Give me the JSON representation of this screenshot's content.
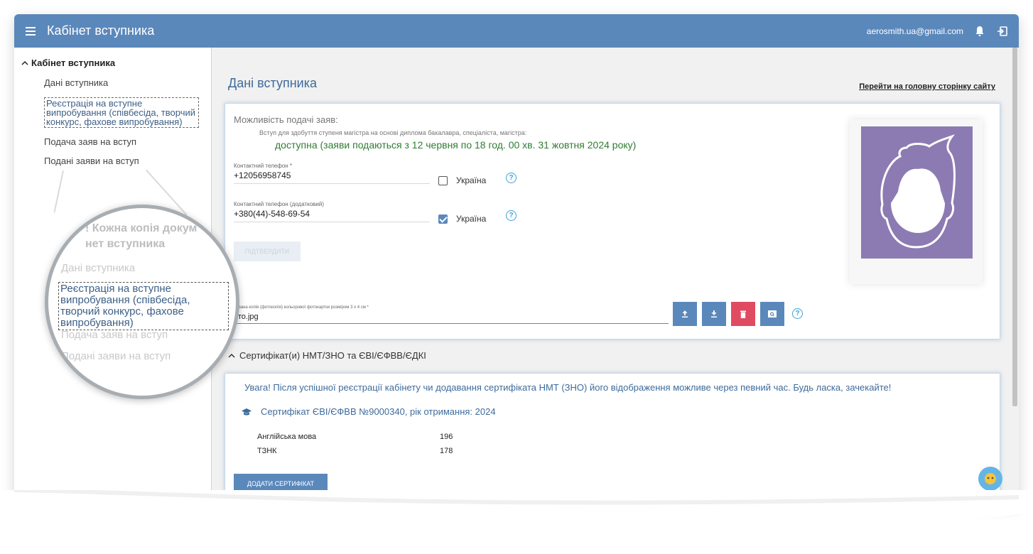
{
  "header": {
    "title": "Кабінет вступника",
    "user_email": "aerosmith.ua@gmail.com"
  },
  "sidebar": {
    "section_title": "Кабінет вступника",
    "items": [
      {
        "label": "Дані вступника"
      },
      {
        "label": "Реєстрація на вступне випробування (співбесіда, творчий конкурс, фахове випробування)"
      },
      {
        "label": "Подача заяв на вступ"
      },
      {
        "label": "Подані заяви на вступ"
      }
    ]
  },
  "main": {
    "page_title": "Дані вступника",
    "home_link": "Перейти на головну сторінку сайту",
    "applications": {
      "heading": "Можливість подачі заяв:",
      "degree_note": "Вступ для здобуття ступеня магістра на основі диплома бакалавра, спеціаліста, магістра:",
      "status": "доступна (заяви подаються з 12 червня по 18 год. 00 хв. 31 жовтня 2024 року)"
    },
    "phone1": {
      "label": "Контактний телефон *",
      "value": "+12056958745",
      "checkbox_label": "Україна",
      "checked": false
    },
    "phone2": {
      "label": "Контактний телефон (додатковий)",
      "value": "+380(44)-548-69-54",
      "checkbox_label": "Україна",
      "checked": true
    },
    "confirm_button": "ПІДТВЕРДИТИ",
    "photo_field": {
      "label": "нована копія (фотокопія) кольорової фотокартки розміром 3 х 4 см *",
      "value": "ото.jpg"
    },
    "certificates": {
      "toggle_label": "Сертифікат(и) НМТ/ЗНО та ЄВІ/ЄФВВ/ЄДКІ",
      "notice": "Увага! Після успішної реєстрації кабінету чи додавання сертифіката НМТ (ЗНО) його відображення можливе через певний час. Будь ласка, зачекайте!",
      "cert_title": "Сертифікат ЄВІ/ЄФВВ №9000340, рік отримання: 2024",
      "subjects": [
        {
          "name": "Англійська мова",
          "score": "196"
        },
        {
          "name": "ТЗНК",
          "score": "178"
        }
      ],
      "add_button": "ДОДАТИ СЕРТИФІКАТ"
    }
  },
  "zoom": {
    "line_top": "! Кожна копія докум",
    "line_section": "нет вступника",
    "items": [
      "Дані вступника",
      "Реєстрація на вступне випробування (співбесіда, творчий конкурс, фахове випробування)",
      "Подача заяв на вступ",
      "Подані заяви на вступ"
    ]
  },
  "colors": {
    "header": "#5b88bb",
    "accent": "#3d6b9b",
    "success": "#2e7d32",
    "danger": "#e04b62",
    "photo_bg": "#8c7bb2"
  }
}
